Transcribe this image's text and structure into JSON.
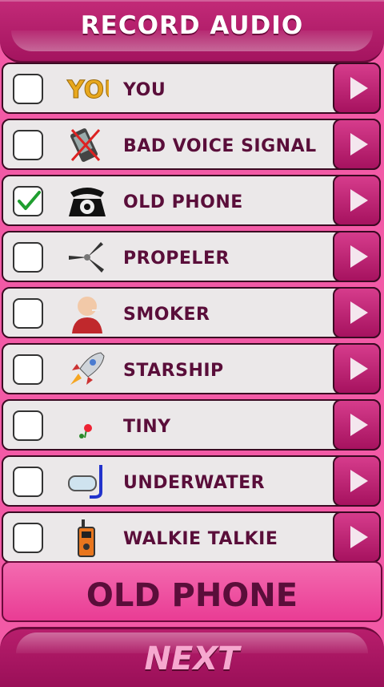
{
  "header": {
    "title": "RECORD AUDIO"
  },
  "effects": [
    {
      "label": "YOU",
      "icon": "you-text-icon",
      "checked": false
    },
    {
      "label": "BAD VOICE SIGNAL",
      "icon": "crossed-phone-icon",
      "checked": false
    },
    {
      "label": "OLD PHONE",
      "icon": "rotary-phone-icon",
      "checked": true
    },
    {
      "label": "PROPELER",
      "icon": "propeller-icon",
      "checked": false
    },
    {
      "label": "SMOKER",
      "icon": "smoker-icon",
      "checked": false
    },
    {
      "label": "STARSHIP",
      "icon": "rocket-icon",
      "checked": false
    },
    {
      "label": "TINY",
      "icon": "tiny-flower-icon",
      "checked": false
    },
    {
      "label": "UNDERWATER",
      "icon": "snorkel-mask-icon",
      "checked": false
    },
    {
      "label": "WALKIE TALKIE",
      "icon": "walkie-talkie-icon",
      "checked": false
    }
  ],
  "selected": {
    "label": "OLD PHONE"
  },
  "footer": {
    "next_label": "NEXT"
  },
  "colors": {
    "accent": "#e93c94",
    "dark": "#5a0e3a",
    "check": "#1f9e2f"
  }
}
